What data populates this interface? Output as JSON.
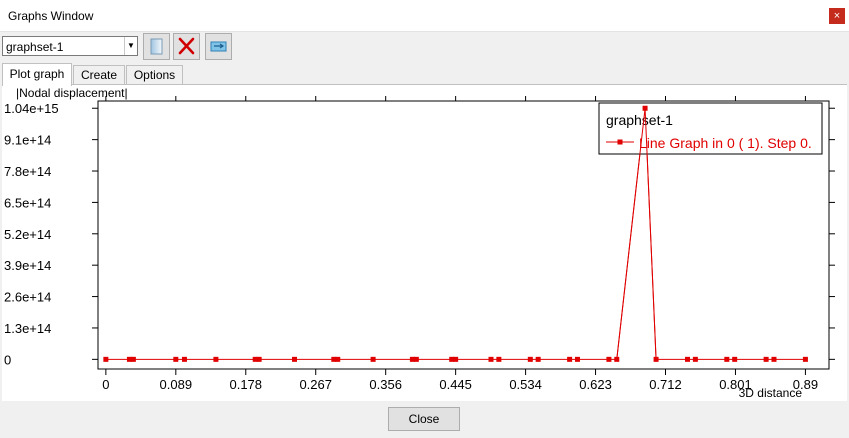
{
  "window": {
    "title": "Graphs Window",
    "close_glyph": "×"
  },
  "toolbar": {
    "graphset_value": "graphset-1",
    "icons": [
      "new-graph-icon",
      "delete-icon",
      "export-icon"
    ]
  },
  "tabs": [
    {
      "label": "Plot graph",
      "active": true
    },
    {
      "label": "Create",
      "active": false
    },
    {
      "label": "Options",
      "active": false
    }
  ],
  "footer": {
    "close_label": "Close"
  },
  "colors": {
    "series": "#e00000",
    "close_button": "#c42b1c"
  },
  "chart_data": {
    "type": "line",
    "title": "|Nodal displacement|",
    "xlabel": "3D distance",
    "ylabel": "",
    "xlim": [
      -0.01,
      0.92
    ],
    "ylim": [
      -40000000000000.0,
      1070000000000000.0
    ],
    "x_ticks": [
      0,
      0.089,
      0.178,
      0.267,
      0.356,
      0.445,
      0.534,
      0.623,
      0.712,
      0.801,
      0.89
    ],
    "x_tick_labels": [
      "0",
      "0.089",
      "0.178",
      "0.267",
      "0.356",
      "0.445",
      "0.534",
      "0.623",
      "0.712",
      "0.801",
      "0.89"
    ],
    "y_ticks": [
      0,
      130000000000000.0,
      260000000000000.0,
      390000000000000.0,
      520000000000000.0,
      650000000000000.0,
      780000000000000.0,
      910000000000000.0,
      1040000000000000.0
    ],
    "y_tick_labels": [
      "0",
      "1.3e+14",
      "2.6e+14",
      "3.9e+14",
      "5.2e+14",
      "6.5e+14",
      "7.8e+14",
      "9.1e+14",
      "1.04e+15"
    ],
    "legend": {
      "title": "graphset-1",
      "placement": "top-right"
    },
    "series": [
      {
        "name": "Line Graph in 0 ( 1). Step 0.",
        "color": "#e00000",
        "x": [
          0,
          0.03,
          0.035,
          0.089,
          0.1,
          0.14,
          0.19,
          0.195,
          0.24,
          0.29,
          0.295,
          0.34,
          0.39,
          0.395,
          0.44,
          0.445,
          0.49,
          0.5,
          0.54,
          0.55,
          0.59,
          0.6,
          0.64,
          0.65,
          0.686,
          0.7,
          0.74,
          0.75,
          0.79,
          0.8,
          0.84,
          0.85,
          0.89
        ],
        "y": [
          0,
          0,
          0,
          0,
          0,
          0,
          0,
          0,
          0,
          0,
          0,
          0,
          0,
          0,
          0,
          0,
          0,
          0,
          0,
          0,
          0,
          0,
          0,
          0,
          1040000000000000.0,
          0,
          0,
          0,
          0,
          0,
          0,
          0,
          0
        ]
      }
    ]
  }
}
